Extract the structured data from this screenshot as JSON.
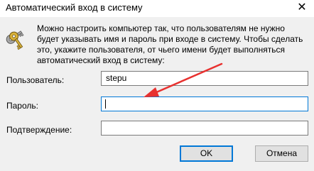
{
  "window": {
    "title": "Автоматический вход в систему",
    "close_glyph": "✕"
  },
  "description": "Можно настроить компьютер так, что пользователям не нужно будет указывать имя и пароль при входе в систему. Чтобы сделать это, укажите пользователя, от чьего имени будет выполняться автоматический вход в систему:",
  "icon": "keys-icon",
  "form": {
    "user_label": "Пользователь:",
    "user_value": "stepu",
    "password_label": "Пароль:",
    "password_value": "",
    "confirm_label": "Подтверждение:",
    "confirm_value": ""
  },
  "buttons": {
    "ok": "OK",
    "cancel": "Отмена"
  },
  "colors": {
    "focus_border": "#0078d7",
    "arrow": "#e8312f",
    "content_bg": "#f0f0f0"
  }
}
